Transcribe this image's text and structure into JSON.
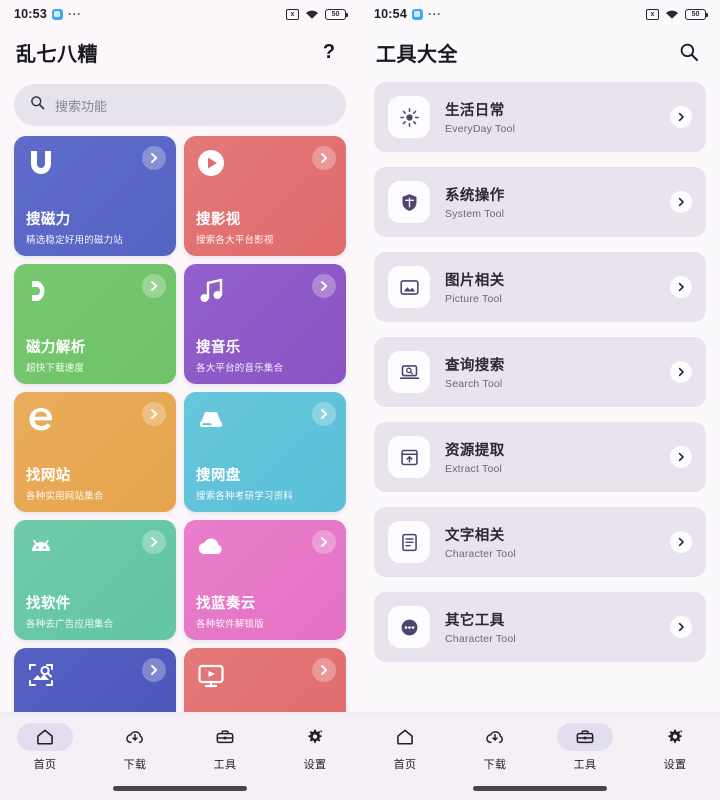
{
  "screens": {
    "left": {
      "status": {
        "time": "10:53",
        "dots": "···",
        "mute_icon": "mute-icon",
        "wifi_icon": "wifi-icon",
        "battery": "50"
      },
      "header": {
        "title": "乱七八糟",
        "action_label": "?",
        "action_icon": "help-question-icon"
      },
      "search": {
        "placeholder": "搜索功能",
        "icon": "search-icon"
      },
      "cards": [
        {
          "title": "搜磁力",
          "subtitle": "精选稳定好用的磁力站",
          "color": "#5563c1",
          "color2": "#5f6ccb",
          "icon": "magnet-u-icon"
        },
        {
          "title": "搜影视",
          "subtitle": "搜索各大平台影视",
          "color": "#e06b6b",
          "color2": "#e47878",
          "icon": "play-circle-icon"
        },
        {
          "title": "磁力解析",
          "subtitle": "超快下载速度",
          "color": "#6ec268",
          "color2": "#79c86f",
          "icon": "magnet-icon"
        },
        {
          "title": "搜音乐",
          "subtitle": "各大平台的音乐集合",
          "color": "#8b54c4",
          "color2": "#9260cc",
          "icon": "music-note-icon"
        },
        {
          "title": "找网站",
          "subtitle": "各种实用网站集合",
          "color": "#e6a44e",
          "color2": "#e9ad5c",
          "icon": "internet-explorer-icon"
        },
        {
          "title": "搜网盘",
          "subtitle": "搜索各种考研学习资料",
          "color": "#5bc0d8",
          "color2": "#66c6dc",
          "icon": "hard-disk-icon"
        },
        {
          "title": "找软件",
          "subtitle": "各种去广告应用集合",
          "color": "#62c5a3",
          "color2": "#6fcbab",
          "icon": "android-icon"
        },
        {
          "title": "找蓝奏云",
          "subtitle": "各种软件解锁版",
          "color": "#e471c4",
          "color2": "#e87ecb",
          "icon": "cloud-icon"
        },
        {
          "title": "",
          "subtitle": "",
          "color": "#4a55b8",
          "color2": "#5561c2",
          "icon": "image-search-icon"
        },
        {
          "title": "",
          "subtitle": "",
          "color": "#e06b6b",
          "color2": "#e47878",
          "icon": "tv-play-icon"
        }
      ],
      "nav": [
        {
          "label": "首页",
          "icon": "home-icon",
          "active": true
        },
        {
          "label": "下载",
          "icon": "cloud-download-icon",
          "active": false
        },
        {
          "label": "工具",
          "icon": "toolbox-icon",
          "active": false
        },
        {
          "label": "设置",
          "icon": "gear-icon",
          "active": false
        }
      ]
    },
    "right": {
      "status": {
        "time": "10:54",
        "dots": "···",
        "mute_icon": "mute-icon",
        "wifi_icon": "wifi-icon",
        "battery": "50"
      },
      "header": {
        "title": "工具大全",
        "action_icon": "search-icon"
      },
      "tools": [
        {
          "title": "生活日常",
          "subtitle": "EveryDay Tool",
          "icon": "sun-icon"
        },
        {
          "title": "系统操作",
          "subtitle": "System Tool",
          "icon": "shield-icon"
        },
        {
          "title": "图片相关",
          "subtitle": "Picture Tool",
          "icon": "picture-icon"
        },
        {
          "title": "查询搜索",
          "subtitle": "Search Tool",
          "icon": "laptop-search-icon"
        },
        {
          "title": "资源提取",
          "subtitle": "Extract Tool",
          "icon": "archive-upload-icon"
        },
        {
          "title": "文字相关",
          "subtitle": "Character Tool",
          "icon": "document-text-icon"
        },
        {
          "title": "其它工具",
          "subtitle": "Character Tool",
          "icon": "dots-circle-icon"
        }
      ],
      "nav": [
        {
          "label": "首页",
          "icon": "home-icon",
          "active": false
        },
        {
          "label": "下载",
          "icon": "cloud-download-icon",
          "active": false
        },
        {
          "label": "工具",
          "icon": "toolbox-icon",
          "active": true
        },
        {
          "label": "设置",
          "icon": "gear-icon",
          "active": false
        }
      ]
    }
  }
}
